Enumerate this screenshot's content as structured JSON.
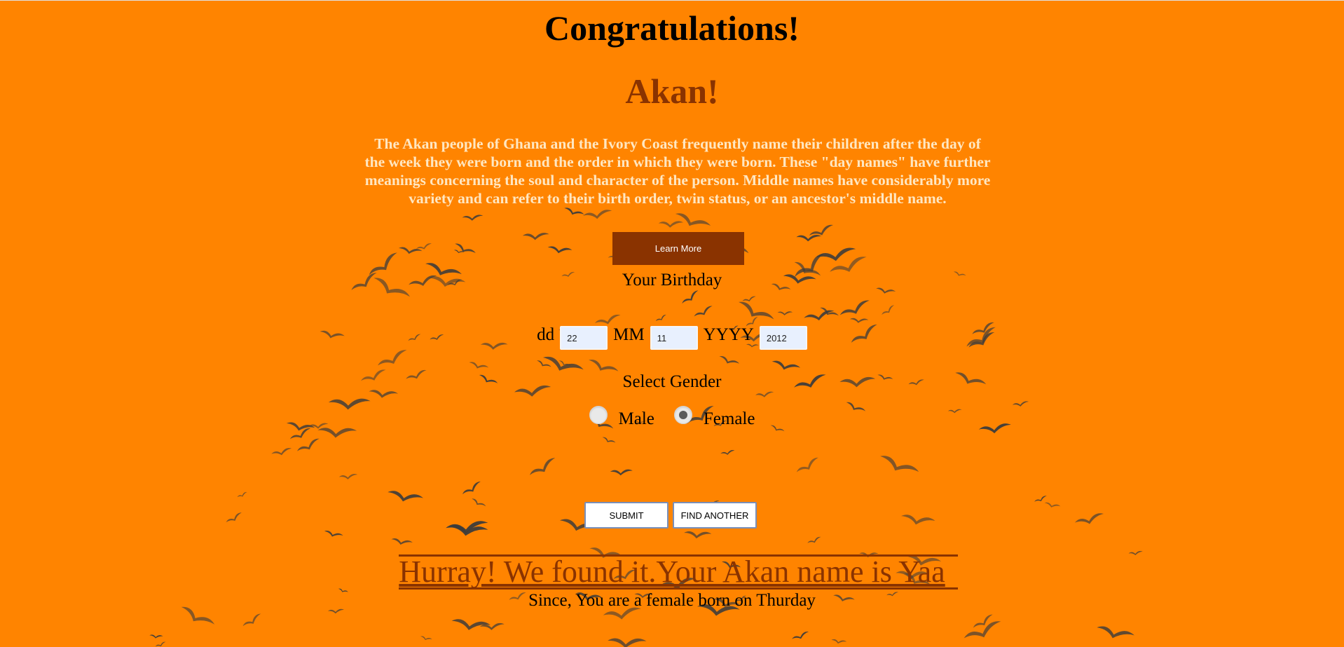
{
  "header": {
    "title": "Congratulations!",
    "subtitle": "Akan!"
  },
  "intro": {
    "description": "The Akan people of Ghana and the Ivory Coast frequently name their children after the day of the week they were born and the order in which they were born. These \"day names\" have further meanings concerning the soul and character of the person. Middle names have considerably more variety and can refer to their birth order, twin status, or an ancestor's middle name.",
    "learn_more_label": "Learn More"
  },
  "form": {
    "birthday_label": "Your Birthday",
    "day_label": "dd",
    "day_value": "22",
    "month_label": "MM",
    "month_value": "11",
    "year_label": "YYYY",
    "year_value": "2012",
    "gender_label": "Select Gender",
    "gender_options": [
      {
        "label": "Male",
        "checked": false
      },
      {
        "label": "Female",
        "checked": true
      }
    ],
    "submit_label": "SUBMIT",
    "find_another_label": "FIND ANOTHER"
  },
  "result": {
    "headline": "Hurray! We found it.Your Akan name is Yaa",
    "detail": "Since, You are a female born on Thurday"
  },
  "colors": {
    "background": "#ff8400",
    "accent": "#8a3300",
    "description_text": "#ffe7c2",
    "input_background": "#e8f0fe"
  }
}
